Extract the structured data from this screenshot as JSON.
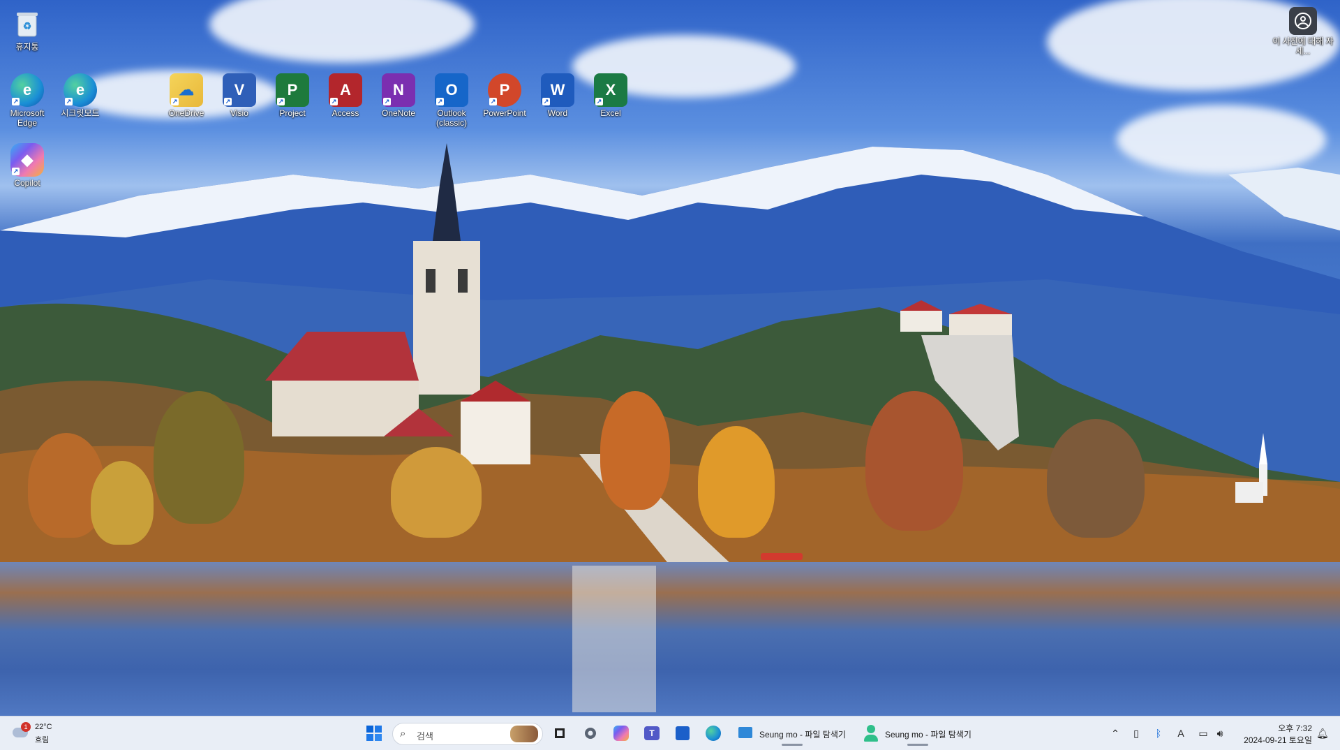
{
  "desktop": {
    "icons": [
      {
        "key": "recycle",
        "label": "휴지통",
        "color": "#cfd8e2",
        "letter": "♻"
      },
      {
        "key": "edge",
        "label": "Microsoft Edge",
        "color": "#1a8fd6",
        "letter": "e"
      },
      {
        "key": "edge-inprivate",
        "label": "시크릿모드",
        "color": "#1a8fd6",
        "letter": "e"
      },
      {
        "key": "onedrive",
        "label": "OneDrive",
        "color": "#f2c744",
        "letter": "☁"
      },
      {
        "key": "visio",
        "label": "Visio",
        "color": "#2f5fb8",
        "letter": "V"
      },
      {
        "key": "project",
        "label": "Project",
        "color": "#1e7a3c",
        "letter": "P"
      },
      {
        "key": "access",
        "label": "Access",
        "color": "#b3262c",
        "letter": "A"
      },
      {
        "key": "onenote",
        "label": "OneNote",
        "color": "#7b2fb0",
        "letter": "N"
      },
      {
        "key": "outlook",
        "label": "Outlook (classic)",
        "color": "#1666c9",
        "letter": "O"
      },
      {
        "key": "powerpoint",
        "label": "PowerPoint",
        "color": "#d2472a",
        "letter": "P"
      },
      {
        "key": "word",
        "label": "Word",
        "color": "#1f5bbd",
        "letter": "W"
      },
      {
        "key": "excel",
        "label": "Excel",
        "color": "#1b7a44",
        "letter": "X"
      },
      {
        "key": "copilot",
        "label": "Copilot",
        "color": "#5b6ee0",
        "letter": "◆"
      }
    ],
    "spotlight_label": "이 사진에 대해 자세..."
  },
  "taskbar": {
    "weather": {
      "temp": "22°C",
      "condition": "흐림",
      "badge": "1"
    },
    "search_placeholder": "검색",
    "windows": [
      {
        "label": "Seung mo - 파일 탐색기"
      },
      {
        "label": "Seung mo - 파일 탐색기"
      }
    ],
    "clock": {
      "time": "오후 7:32",
      "date": "2024-09-21 토요일"
    },
    "ime": "A"
  },
  "colors": {
    "taskbar_bg": "#e9eef6",
    "accent": "#0a64d8"
  }
}
